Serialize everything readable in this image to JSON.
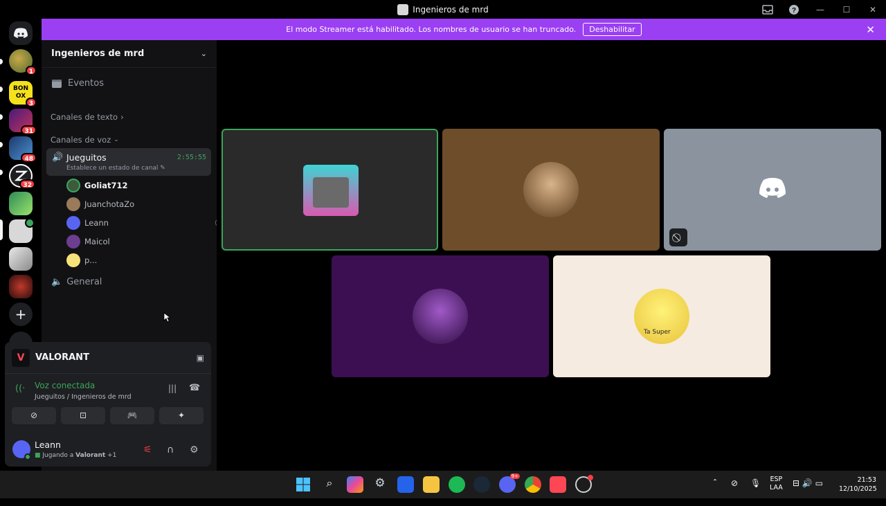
{
  "window": {
    "title": "Ingenieros de mrd"
  },
  "banner": {
    "text": "El modo Streamer está habilitado. Los nombres de usuario se han truncado.",
    "button": "Deshabilitar"
  },
  "servers": {
    "badges": [
      "1",
      "3",
      "31",
      "48",
      "32"
    ]
  },
  "sidebar": {
    "server_name": "Ingenieros de mrd",
    "events": "Eventos",
    "text_category": "Canales de texto",
    "voice_category": "Canales de voz",
    "voice_channel": {
      "name": "Jueguitos",
      "timer": "2:55:55",
      "status": "Establece un estado de canal"
    },
    "users": [
      {
        "name": "Goliat712"
      },
      {
        "name": "JuanchotaZo"
      },
      {
        "name": "Leann"
      },
      {
        "name": "Maicol"
      },
      {
        "name": "p..."
      }
    ],
    "general": "General"
  },
  "panel": {
    "game": "VALORANT",
    "voice_status": "Voz conectada",
    "voice_channel": "Jueguitos / Ingenieros de mrd",
    "user_name": "Leann",
    "user_activity": "Jugando a",
    "user_activity_game": "Valorant",
    "user_activity_extra": "+1"
  },
  "stage": {
    "tile5_text": "Ta Super"
  },
  "taskbar": {
    "lang": "ESP",
    "layout": "LAA",
    "time": "21:53",
    "date": "12/10/2025",
    "discord_badge": "9+"
  },
  "colors": {
    "accent_green": "#3ba55c",
    "streamer_purple": "#9b3ff3",
    "danger": "#f23f43"
  }
}
